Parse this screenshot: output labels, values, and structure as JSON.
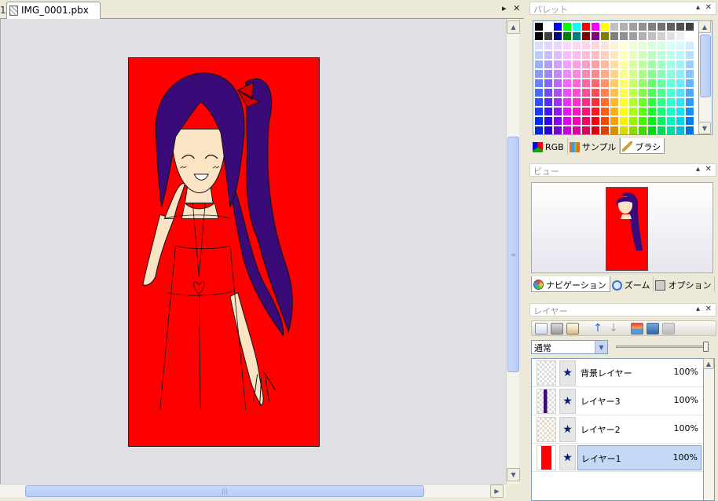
{
  "tabs": [
    {
      "label": "1",
      "active": false
    },
    {
      "label": "IMG_0001.pbx",
      "active": true
    }
  ],
  "tab_controls": {
    "scroll_right": "▸",
    "close": "✕"
  },
  "panels": {
    "palette": {
      "title": "パレット",
      "subtabs": [
        "RGB",
        "サンプル",
        "ブラシ"
      ],
      "active_subtab": "ブラシ"
    },
    "view": {
      "title": "ビュー",
      "subtabs": [
        "ナビゲーション",
        "ズーム",
        "オプション"
      ],
      "active_subtab": "ナビゲーション"
    },
    "layer": {
      "title": "レイヤー",
      "blend_mode": "通常",
      "opacity_value": 1.0,
      "layers": [
        {
          "name": "背景レイヤー",
          "opacity": "100%",
          "visible_icon": "★",
          "thumb": "sketch",
          "selected": false
        },
        {
          "name": "レイヤー3",
          "opacity": "100%",
          "visible_icon": "★",
          "thumb": "hair",
          "selected": false
        },
        {
          "name": "レイヤー2",
          "opacity": "100%",
          "visible_icon": "★",
          "thumb": "skin",
          "selected": false
        },
        {
          "name": "レイヤー1",
          "opacity": "100%",
          "visible_icon": "★",
          "thumb": "red",
          "selected": true
        }
      ]
    }
  },
  "panel_buttons": {
    "pin": "▴",
    "close": "✕"
  },
  "colors": {
    "canvas_fill": "#ff0000",
    "hair": "#3a0a78",
    "skin": "#fbe4c4",
    "selection": "#c4d9f5"
  },
  "icons": [
    "file-icon",
    "new-layer-icon",
    "delete-layer-icon",
    "layer-properties-icon",
    "move-up-icon",
    "move-down-icon",
    "merge-down-icon",
    "merge-visible-icon",
    "clip-icon"
  ]
}
